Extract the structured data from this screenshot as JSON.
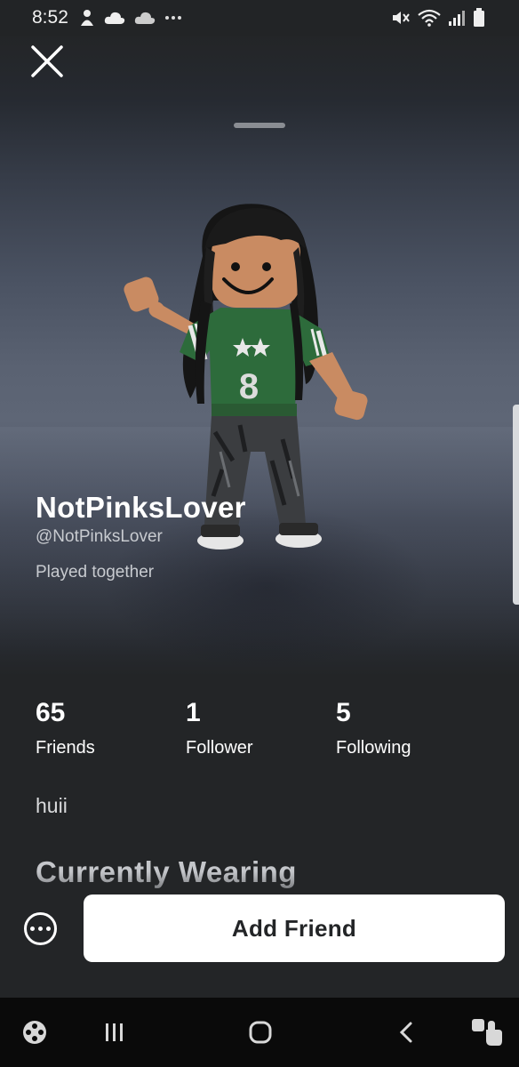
{
  "status_bar": {
    "time": "8:52",
    "left_icons": [
      "emoji-icon",
      "cloud-icon",
      "cloud-outline-icon",
      "more-dots-icon"
    ],
    "right_icons": [
      "mute-icon",
      "wifi-icon",
      "signal-icon",
      "battery-icon"
    ]
  },
  "profile": {
    "display_name": "NotPinksLover",
    "username": "@NotPinksLover",
    "relationship": "Played together",
    "stats": [
      {
        "count": "65",
        "label": "Friends"
      },
      {
        "count": "1",
        "label": "Follower"
      },
      {
        "count": "5",
        "label": "Following"
      }
    ],
    "bio": "huii",
    "section_title": "Currently Wearing"
  },
  "actions": {
    "add_friend_label": "Add Friend",
    "more_icon": "more-options-icon"
  },
  "nav_bar": {
    "icons": [
      "game-launcher-icon",
      "recent-apps-icon",
      "home-icon",
      "back-icon",
      "accessibility-icon"
    ]
  },
  "colors": {
    "background": "#232527",
    "button": "#ffffff",
    "button_text": "#232527",
    "shirt": "#2d6b3b",
    "skin": "#c98b62"
  }
}
